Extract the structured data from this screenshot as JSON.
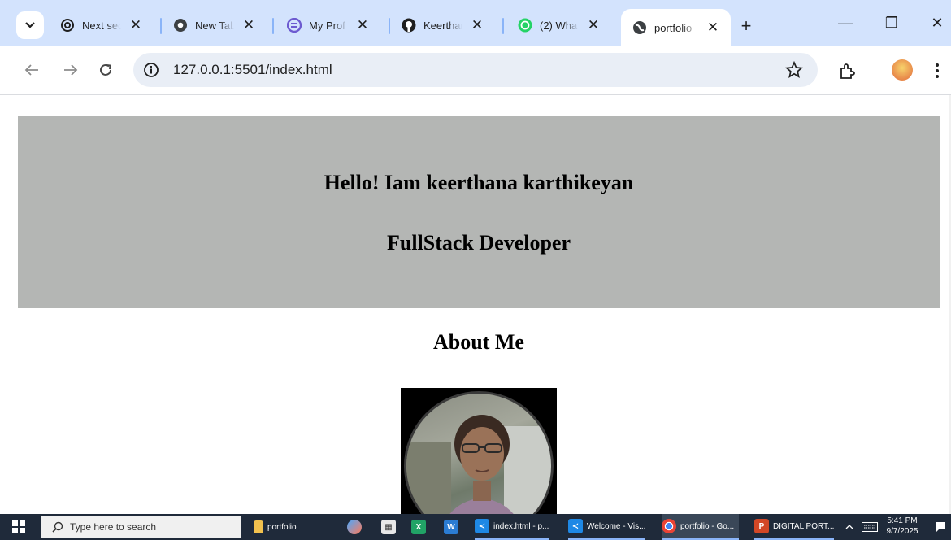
{
  "browser": {
    "tabs": [
      {
        "title": "Next sec",
        "favicon": "openai-icon",
        "active": false
      },
      {
        "title": "New Tab",
        "favicon": "chrome-icon",
        "active": false
      },
      {
        "title": "My Prof",
        "favicon": "profile-app-icon",
        "active": false
      },
      {
        "title": "Keerthan",
        "favicon": "github-icon",
        "active": false
      },
      {
        "title": "(2) Wha",
        "favicon": "whatsapp-icon",
        "active": false
      },
      {
        "title": "portfolio",
        "favicon": "globe-icon",
        "active": true
      }
    ],
    "close_glyph": "✕",
    "new_tab_glyph": "+",
    "url": "127.0.0.1:5501/index.html",
    "window_controls": {
      "minimize": "—",
      "maximize": "❐",
      "close": "✕"
    }
  },
  "page": {
    "hero_line1": "Hello! Iam keerthana karthikeyan",
    "hero_line2": "FullStack Developer",
    "about_title": "About Me",
    "hero_bg": "#b4b6b4"
  },
  "taskbar": {
    "search_placeholder": "Type here to search",
    "items": [
      {
        "label": "portfolio",
        "icon": "folder-icon"
      },
      {
        "label": "index.html - p...",
        "icon": "vscode-icon"
      },
      {
        "label": "Welcome - Vis...",
        "icon": "vscode-icon"
      },
      {
        "label": "portfolio - Go...",
        "icon": "chrome-icon"
      },
      {
        "label": "DIGITAL PORT...",
        "icon": "powerpoint-icon"
      }
    ],
    "time": "5:41 PM",
    "date": "9/7/2025"
  }
}
